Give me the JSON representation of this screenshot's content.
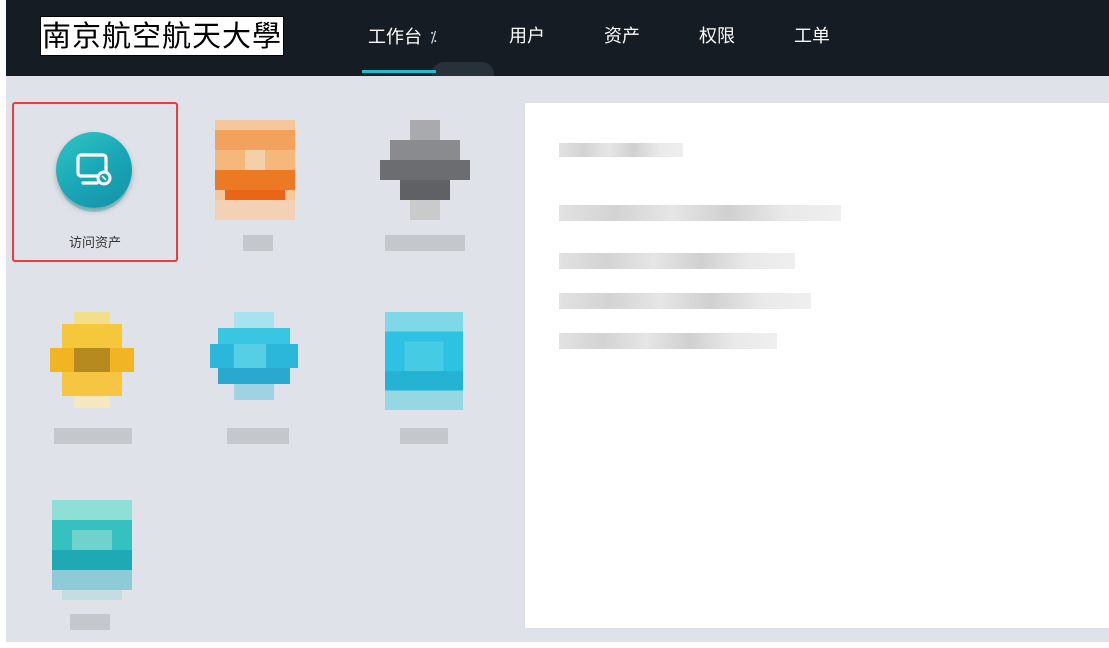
{
  "header": {
    "logo_text": "南京航空航天大學",
    "nav": [
      {
        "label": "工作台",
        "active": true,
        "pinned": true
      },
      {
        "label": "用户"
      },
      {
        "label": "资产"
      },
      {
        "label": "权限"
      },
      {
        "label": "工单"
      }
    ],
    "accent_color": "#1ec0cf",
    "bar_color": "#161c24"
  },
  "workspace": {
    "apps": [
      {
        "label": "访问资产",
        "icon": "monitor-icon",
        "selected": true,
        "highlight_color": "#ef3b3b"
      }
    ],
    "background_color": "#dfe3e9"
  }
}
